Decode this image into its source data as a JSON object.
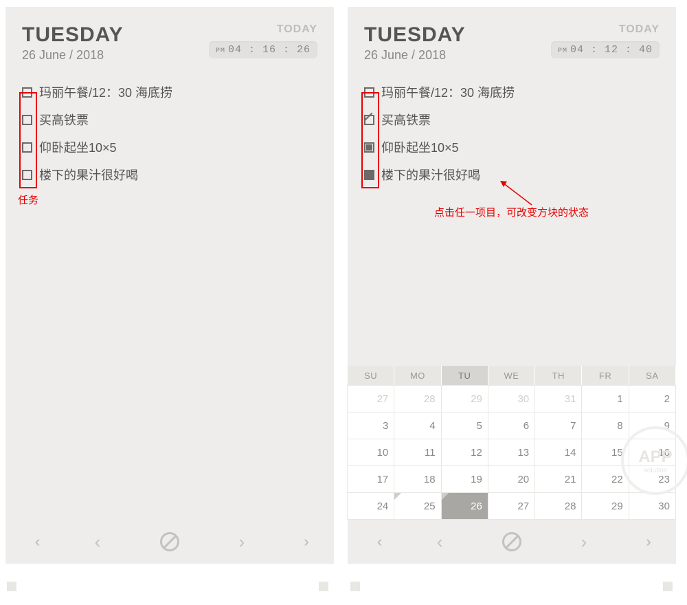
{
  "left": {
    "day_name": "TUESDAY",
    "day_date": "26 June / 2018",
    "today_label": "TODAY",
    "clock_ampm": "PM",
    "clock_time": "04 : 16 : 26",
    "tasks": [
      {
        "text": "玛丽午餐/12：30 海底捞",
        "state": "empty"
      },
      {
        "text": "买高铁票",
        "state": "empty"
      },
      {
        "text": "仰卧起坐10×5",
        "state": "empty"
      },
      {
        "text": "楼下的果汁很好喝",
        "state": "empty"
      }
    ],
    "annotation": "任务"
  },
  "right": {
    "day_name": "TUESDAY",
    "day_date": "26 June / 2018",
    "today_label": "TODAY",
    "clock_ampm": "PM",
    "clock_time": "04 : 12 : 40",
    "tasks": [
      {
        "text": "玛丽午餐/12：30 海底捞",
        "state": "empty"
      },
      {
        "text": "买高铁票",
        "state": "slash"
      },
      {
        "text": "仰卧起坐10×5",
        "state": "half"
      },
      {
        "text": "楼下的果汁很好喝",
        "state": "full"
      }
    ],
    "annotation": "点击任一项目，可改变方块的状态",
    "calendar": {
      "weekdays": [
        "SU",
        "MO",
        "TU",
        "WE",
        "TH",
        "FR",
        "SA"
      ],
      "selected_weekday_index": 2,
      "cells": [
        {
          "n": 27,
          "other": true
        },
        {
          "n": 28,
          "other": true
        },
        {
          "n": 29,
          "other": true
        },
        {
          "n": 30,
          "other": true
        },
        {
          "n": 31,
          "other": true
        },
        {
          "n": 1
        },
        {
          "n": 2
        },
        {
          "n": 3
        },
        {
          "n": 4
        },
        {
          "n": 5
        },
        {
          "n": 6
        },
        {
          "n": 7
        },
        {
          "n": 8
        },
        {
          "n": 9
        },
        {
          "n": 10
        },
        {
          "n": 11
        },
        {
          "n": 12
        },
        {
          "n": 13
        },
        {
          "n": 14
        },
        {
          "n": 15
        },
        {
          "n": 16
        },
        {
          "n": 17
        },
        {
          "n": 18
        },
        {
          "n": 19
        },
        {
          "n": 20
        },
        {
          "n": 21
        },
        {
          "n": 22
        },
        {
          "n": 23
        },
        {
          "n": 24
        },
        {
          "n": 25,
          "corner": true
        },
        {
          "n": 26,
          "today": true,
          "corner": true
        },
        {
          "n": 27
        },
        {
          "n": 28
        },
        {
          "n": 29
        },
        {
          "n": 30
        }
      ]
    }
  },
  "watermark": {
    "big": "APP",
    "small": "solution"
  }
}
